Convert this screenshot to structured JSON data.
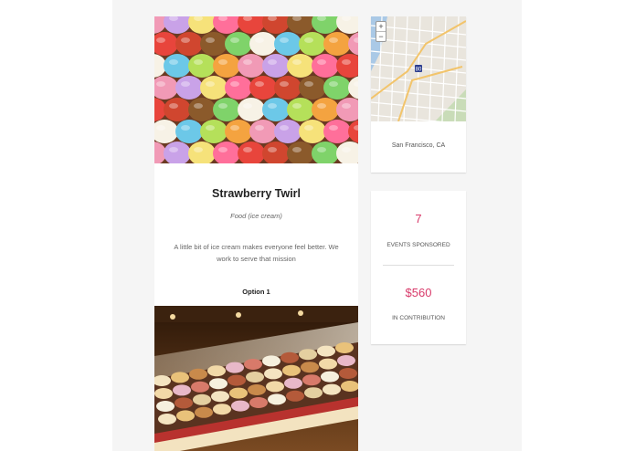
{
  "listing": {
    "title": "Strawberry Twirl",
    "category": "Food (ice cream)",
    "description": "A little bit of ice cream makes everyone feel better. We work to serve that mission",
    "option_label": "Option 1"
  },
  "location": {
    "text": "San Francisco, CA",
    "zoom_in": "+",
    "zoom_out": "−"
  },
  "stats": [
    {
      "value": "7",
      "label": "EVENTS SPONSORED"
    },
    {
      "value": "$560",
      "label": "IN CONTRIBUTION"
    }
  ],
  "colors": {
    "accent": "#d83a6a",
    "background": "#f5f5f5",
    "card": "#ffffff"
  },
  "icons": [
    "zoom-in-icon",
    "zoom-out-icon",
    "map-marker-icon"
  ]
}
